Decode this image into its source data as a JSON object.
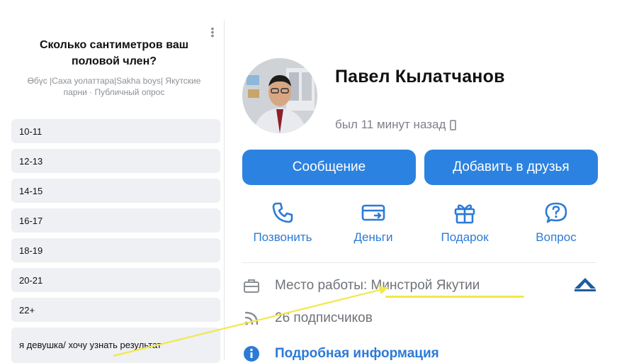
{
  "poll": {
    "question": "Сколько сантиметров ваш половой член?",
    "meta": "Өбүс |Саха уолаттара|Sakha boys| Якутские парни · Публичный опрос",
    "options": [
      "10-11",
      "12-13",
      "14-15",
      "16-17",
      "18-19",
      "20-21",
      "22+",
      "я девушка/ хочу узнать результат"
    ]
  },
  "profile": {
    "name": "Павел Кылатчанов",
    "last_seen": "был 11 минут назад",
    "buttons": {
      "message": "Сообщение",
      "add_friend": "Добавить в друзья"
    },
    "actions": {
      "call": "Позвонить",
      "money": "Деньги",
      "gift": "Подарок",
      "question": "Вопрос"
    },
    "work_label": "Место работы:",
    "work_value": "Минстрой Якутии",
    "followers": "26 подписчиков",
    "more_info": "Подробная информация"
  },
  "colors": {
    "accent": "#2c82e0",
    "highlight": "#f1e84a",
    "option_bg": "#eef0f3"
  }
}
